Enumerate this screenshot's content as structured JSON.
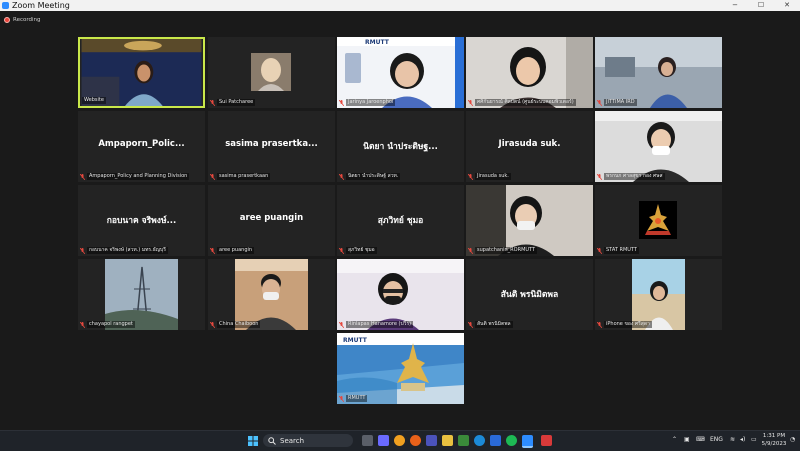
{
  "window": {
    "title": "Zoom Meeting",
    "recording_label": "Recording",
    "controls": {
      "minimize": "−",
      "maximize": "☐",
      "close": "✕"
    }
  },
  "participants": [
    {
      "id": "website",
      "label": "Website",
      "display_text": "",
      "muted": false,
      "active": true
    },
    {
      "id": "sui",
      "label": "Sui Patcharee",
      "display_text": "",
      "muted": true
    },
    {
      "id": "jarinya",
      "label": "Jarinya Jaroenphol",
      "display_text": "",
      "muted": true
    },
    {
      "id": "thai-name-1",
      "label": "ศศิกันยารณ์ ศิลปัตน์ (ศูนย์ระบบคอมพิวเตอร์)",
      "display_text": "",
      "muted": true
    },
    {
      "id": "jittima",
      "label": "JITTIMA IRD",
      "display_text": "",
      "muted": true
    },
    {
      "id": "ampaporn",
      "label": "Ampaporn_Policy and Planning Division",
      "display_text": "Ampaporn_Polic...",
      "muted": true
    },
    {
      "id": "sasima",
      "label": "sasima prasertkaan",
      "display_text": "sasima prasertka...",
      "muted": true
    },
    {
      "id": "nittaya",
      "label": "นิตยา นำประดิษฐ์ สวท.",
      "display_text": "นิตยา นำประดิษฐ...",
      "muted": true
    },
    {
      "id": "jirasuda",
      "label": "Jirasuda suk.",
      "display_text": "Jirasuda suk.",
      "muted": true
    },
    {
      "id": "pornkanok",
      "label": "พรกนก ศาลสุขา กอง ศษส",
      "display_text": "",
      "muted": true
    },
    {
      "id": "kobnat",
      "label": "กอบนาค จริพงษ์ (สวท.) มทร.ธัญบุรี",
      "display_text": "กอบนาค จริพงษ์...",
      "muted": true
    },
    {
      "id": "aree",
      "label": "aree puangin",
      "display_text": "aree puangin",
      "muted": true
    },
    {
      "id": "suphawit",
      "label": "สุภวิทย์ ชุมอ",
      "display_text": "สุภวิทย์ ชุมอ",
      "muted": true
    },
    {
      "id": "supatchanin",
      "label": "supatchanin_RORMUTT",
      "display_text": "",
      "muted": true
    },
    {
      "id": "stat",
      "label": "STAT RMUTT",
      "display_text": "",
      "muted": true
    },
    {
      "id": "chayapol",
      "label": "chayapol rangpet",
      "display_text": "",
      "muted": true
    },
    {
      "id": "china",
      "label": "China Chaiboon",
      "display_text": "",
      "muted": true
    },
    {
      "id": "rinlapas",
      "label": "Rinlapas Hanamore (ปวิร)",
      "display_text": "",
      "muted": true
    },
    {
      "id": "santi",
      "label": "สันติ พรนิมิตพล",
      "display_text": "สันติ พรนิมิตพล",
      "muted": true
    },
    {
      "id": "iphone",
      "label": "iPhone ของ ศรีสุดา",
      "display_text": "",
      "muted": true
    },
    {
      "id": "rmutt",
      "label": "RMUTT",
      "display_text": "",
      "muted": true
    }
  ],
  "taskbar": {
    "search_label": "Search",
    "language": "ENG",
    "time": "1:31 PM",
    "date": "5/9/2023"
  },
  "colors": {
    "active_speaker_border": "#c9e84a",
    "tile_background": "#232323",
    "muted_icon": "#e5483e"
  }
}
